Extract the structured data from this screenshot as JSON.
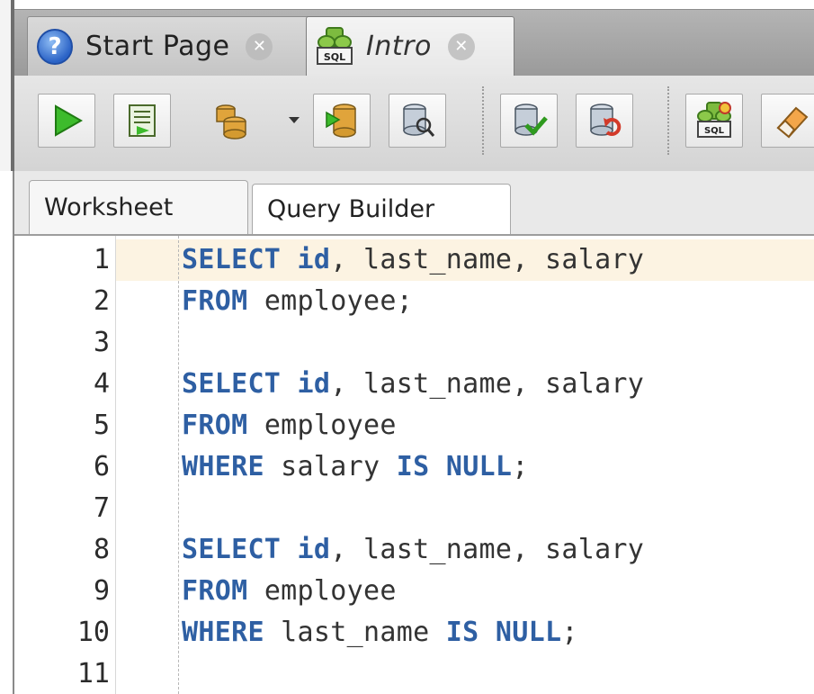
{
  "tabs": [
    {
      "label": "Start Page",
      "icon": "help-icon",
      "active": false
    },
    {
      "label": "Intro",
      "icon": "sql-worksheet-icon",
      "active": true
    }
  ],
  "toolbar": {
    "buttons": [
      {
        "name": "run-statement-button",
        "icon": "play-icon"
      },
      {
        "name": "run-script-button",
        "icon": "script-icon"
      },
      {
        "name": "autotrace-button",
        "icon": "db-cylinders-icon"
      },
      {
        "name": "explain-plan-button",
        "icon": "db-explain-icon"
      },
      {
        "name": "sql-tuning-button",
        "icon": "db-tuning-icon"
      },
      {
        "name": "commit-button",
        "icon": "db-commit-icon"
      },
      {
        "name": "rollback-button",
        "icon": "db-rollback-icon"
      },
      {
        "name": "unshared-sql-button",
        "icon": "sql-worksheet-icon"
      },
      {
        "name": "clear-button",
        "icon": "eraser-icon"
      }
    ]
  },
  "subtabs": [
    {
      "label": "Worksheet",
      "active": true
    },
    {
      "label": "Query Builder",
      "active": false
    }
  ],
  "editor": {
    "current_line": 1,
    "lines": [
      {
        "n": "1",
        "tokens": [
          {
            "t": "SELECT",
            "c": "kw"
          },
          {
            "t": " "
          },
          {
            "t": "id",
            "c": "id"
          },
          {
            "t": ", last_name, salary"
          }
        ]
      },
      {
        "n": "2",
        "tokens": [
          {
            "t": "FROM",
            "c": "kw"
          },
          {
            "t": " employee;"
          }
        ]
      },
      {
        "n": "3",
        "tokens": []
      },
      {
        "n": "4",
        "tokens": [
          {
            "t": "SELECT",
            "c": "kw"
          },
          {
            "t": " "
          },
          {
            "t": "id",
            "c": "id"
          },
          {
            "t": ", last_name, salary"
          }
        ]
      },
      {
        "n": "5",
        "tokens": [
          {
            "t": "FROM",
            "c": "kw"
          },
          {
            "t": " employee"
          }
        ]
      },
      {
        "n": "6",
        "tokens": [
          {
            "t": "WHERE",
            "c": "kw"
          },
          {
            "t": " salary "
          },
          {
            "t": "IS",
            "c": "kw"
          },
          {
            "t": " "
          },
          {
            "t": "NULL",
            "c": "kw"
          },
          {
            "t": ";"
          }
        ]
      },
      {
        "n": "7",
        "tokens": []
      },
      {
        "n": "8",
        "tokens": [
          {
            "t": "SELECT",
            "c": "kw"
          },
          {
            "t": " "
          },
          {
            "t": "id",
            "c": "id"
          },
          {
            "t": ", last_name, salary"
          }
        ]
      },
      {
        "n": "9",
        "tokens": [
          {
            "t": "FROM",
            "c": "kw"
          },
          {
            "t": " employee"
          }
        ]
      },
      {
        "n": "10",
        "tokens": [
          {
            "t": "WHERE",
            "c": "kw"
          },
          {
            "t": " last_name "
          },
          {
            "t": "IS",
            "c": "kw"
          },
          {
            "t": " "
          },
          {
            "t": "NULL",
            "c": "kw"
          },
          {
            "t": ";"
          }
        ]
      },
      {
        "n": "11",
        "tokens": []
      }
    ]
  },
  "colors": {
    "keyword": "#2e5fa3",
    "current_line": "#fcf3e2"
  }
}
